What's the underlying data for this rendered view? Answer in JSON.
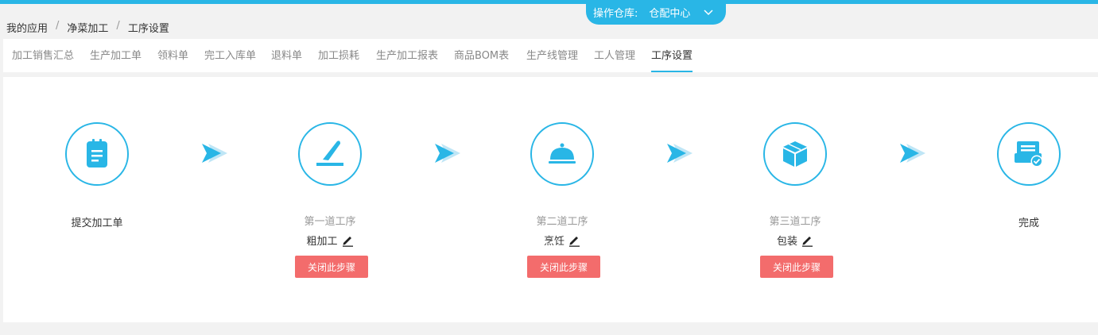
{
  "header": {
    "warehouse_label": "操作仓库:",
    "warehouse_value": "仓配中心"
  },
  "breadcrumb": [
    "我的应用",
    "净菜加工",
    "工序设置"
  ],
  "tabs": [
    {
      "label": "加工销售汇总"
    },
    {
      "label": "生产加工单"
    },
    {
      "label": "领料单"
    },
    {
      "label": "完工入库单"
    },
    {
      "label": "退料单"
    },
    {
      "label": "加工损耗"
    },
    {
      "label": "生产加工报表"
    },
    {
      "label": "商品BOM表"
    },
    {
      "label": "生产线管理"
    },
    {
      "label": "工人管理"
    },
    {
      "label": "工序设置",
      "active": true
    }
  ],
  "steps": [
    {
      "title": "提交加工单",
      "icon": "document-icon"
    },
    {
      "subtitle": "第一道工序",
      "name": "粗加工",
      "button": "关闭此步骤",
      "icon": "knife-icon"
    },
    {
      "subtitle": "第二道工序",
      "name": "烹饪",
      "button": "关闭此步骤",
      "icon": "cloche-icon"
    },
    {
      "subtitle": "第三道工序",
      "name": "包装",
      "button": "关闭此步骤",
      "icon": "box-icon"
    },
    {
      "title": "完成",
      "icon": "completed-icon"
    }
  ],
  "colors": {
    "accent": "#29b6e6",
    "danger": "#f36c6c"
  }
}
